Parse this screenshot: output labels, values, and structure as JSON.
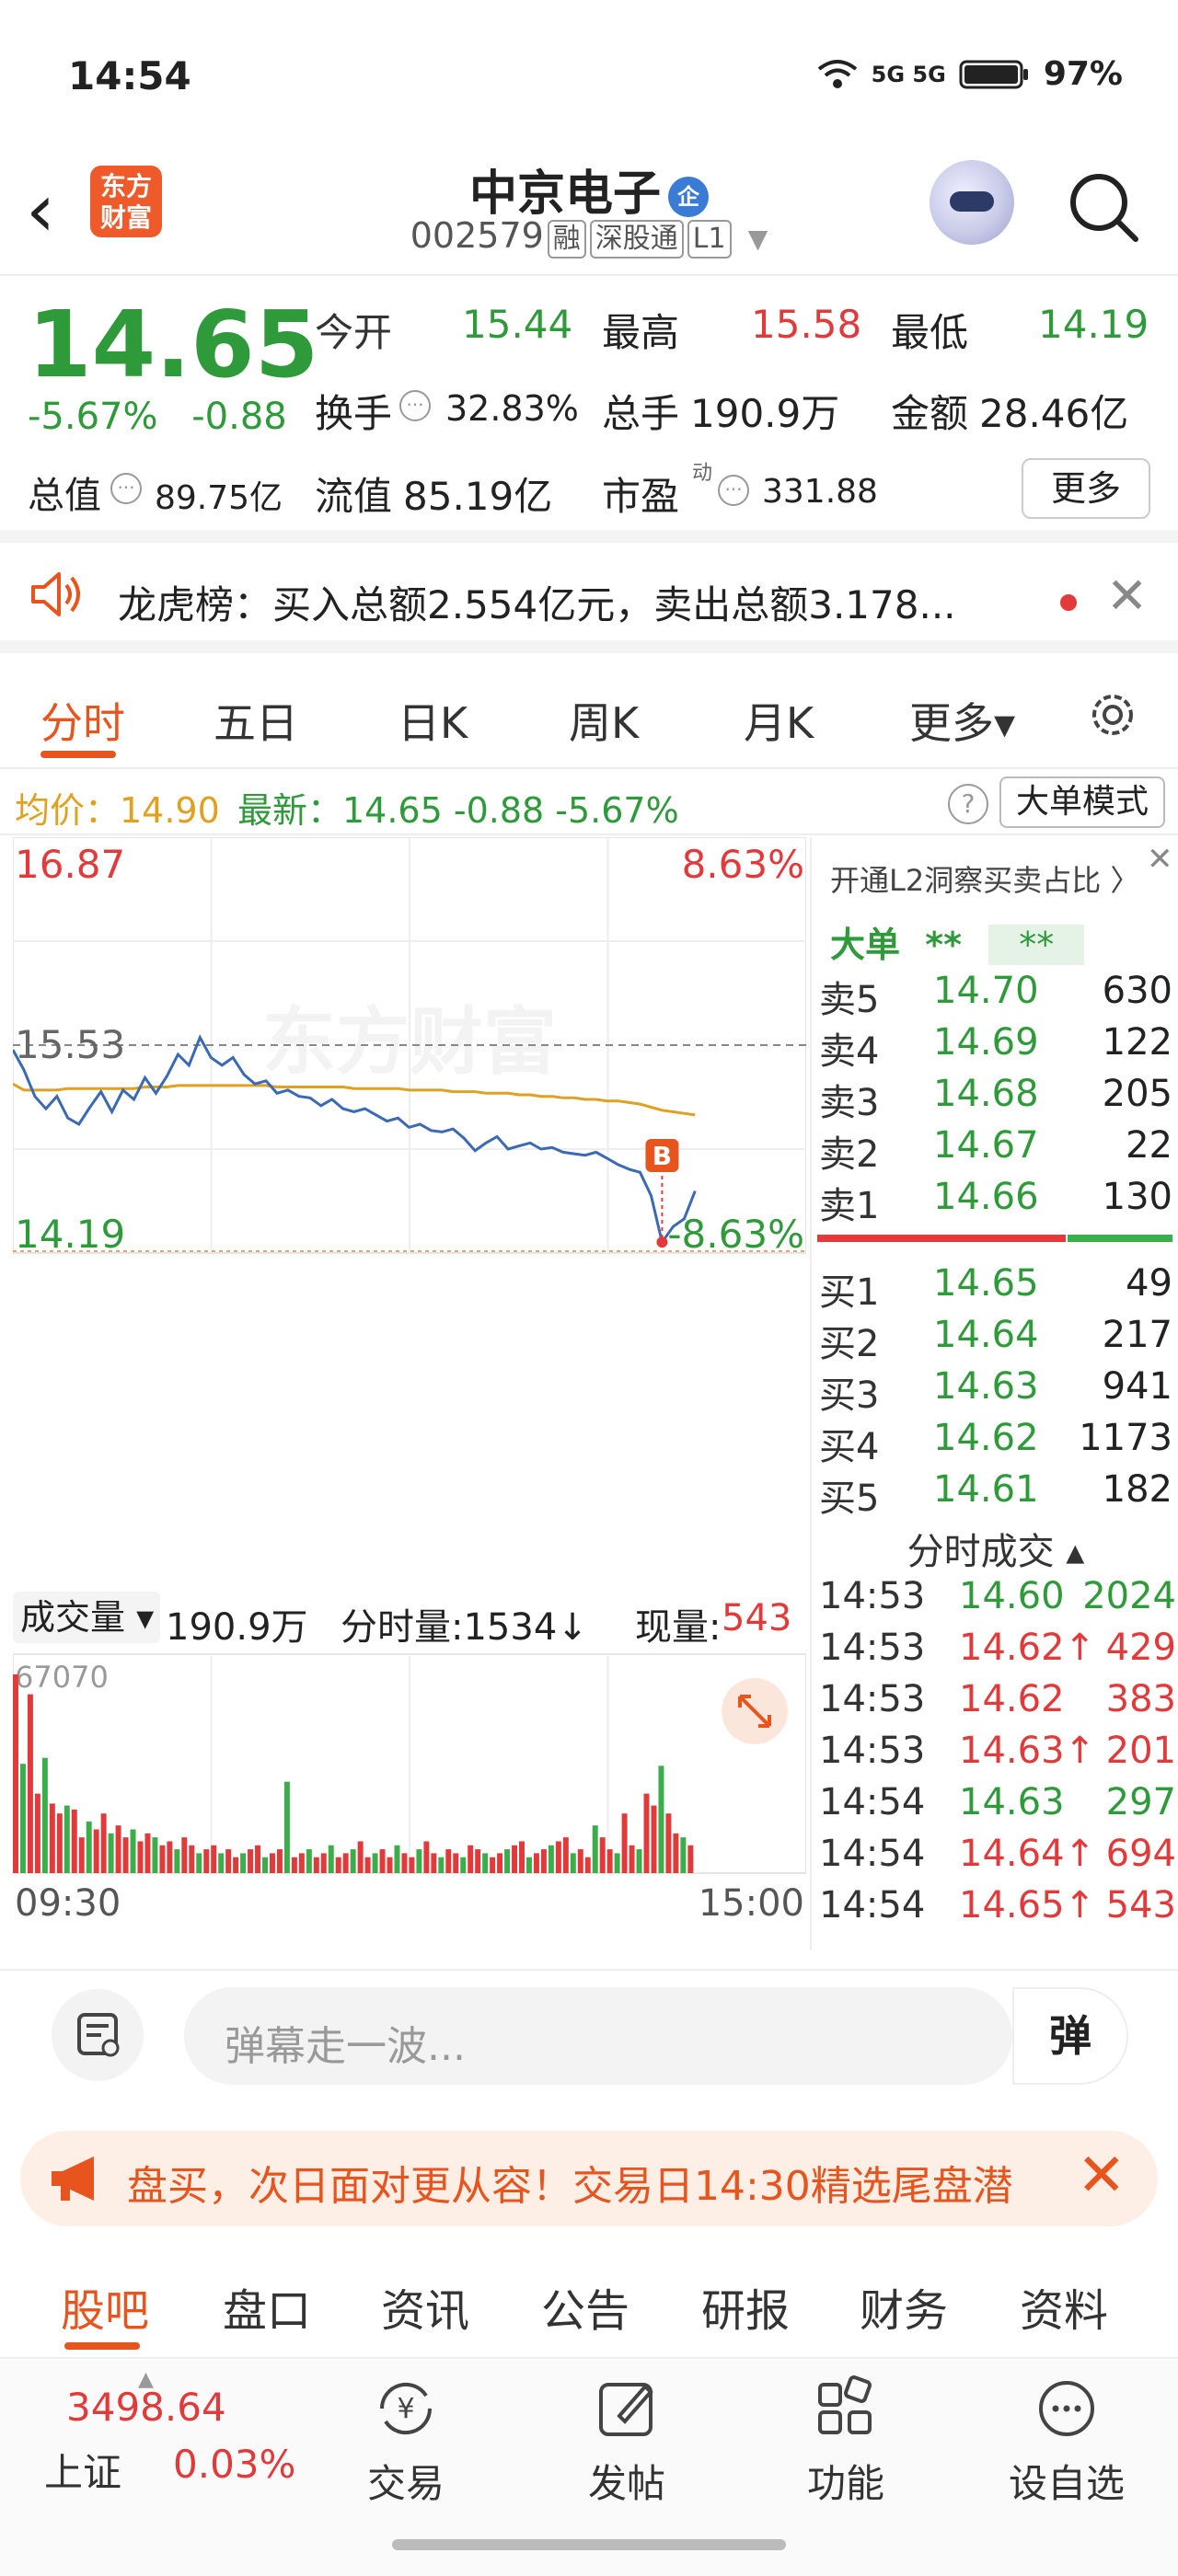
{
  "status_bar": {
    "time": "14:54",
    "network": "5G 5G",
    "battery": "97%"
  },
  "header": {
    "logo_text": "东方财富",
    "stock_name": "中京电子",
    "enterprise_badge": "企",
    "stock_code": "002579",
    "tags": [
      "融",
      "深股通",
      "L1"
    ]
  },
  "quote": {
    "price": "14.65",
    "change_pct": "-5.67%",
    "change": "-0.88",
    "fields": [
      {
        "label": "今开",
        "value": "15.44",
        "color": "#2e9a3a"
      },
      {
        "label": "最高",
        "value": "15.58",
        "color": "#e23a3a"
      },
      {
        "label": "最低",
        "value": "14.19",
        "color": "#2e9a3a"
      },
      {
        "label": "换手",
        "value": "32.83%",
        "color": "#222222"
      },
      {
        "label": "总手",
        "value": "190.9万",
        "color": "#222222"
      },
      {
        "label": "金额",
        "value": "28.46亿",
        "color": "#222222"
      },
      {
        "label": "总值",
        "value": "89.75亿",
        "color": "#222222"
      },
      {
        "label": "流值",
        "value": "85.19亿",
        "color": "#222222"
      },
      {
        "label": "市盈",
        "value": "331.88",
        "color": "#222222"
      }
    ],
    "pe_superscript": "动",
    "more_label": "更多"
  },
  "notice": {
    "text": "龙虎榜：买入总额2.554亿元，卖出总额3.178..."
  },
  "chart_tabs": [
    "分时",
    "五日",
    "日K",
    "周K",
    "月K",
    "更多▾"
  ],
  "avg_line": {
    "avg_label": "均价：14.90",
    "latest_label": "最新：14.65  -0.88  -5.67%",
    "help": "?",
    "mode_label": "大单模式"
  },
  "chart_labels": {
    "top_price": "16.87",
    "top_pct": "8.63%",
    "mid_price": "15.53",
    "bottom_price": "14.19",
    "bottom_pct": "-8.63%",
    "watermark": "东方财富",
    "marker": "B",
    "time_start": "09:30",
    "time_end": "15:00",
    "vol_max": "67070"
  },
  "chart_data": {
    "type": "line",
    "x_range": [
      "09:30",
      "15:00"
    ],
    "ylim": [
      14.19,
      16.87
    ],
    "pct_range": [
      "-8.63%",
      "8.63%"
    ],
    "prev_close": 15.53,
    "series": [
      {
        "values": [
          15.5,
          15.37,
          15.2,
          15.12,
          15.2,
          15.06,
          15.02,
          15.13,
          15.23,
          15.1,
          15.24,
          15.18,
          15.32,
          15.22,
          15.33,
          15.47,
          15.4,
          15.58,
          15.45,
          15.4,
          15.45,
          15.34,
          15.28,
          15.3,
          15.22,
          15.24,
          15.2,
          15.19,
          15.14,
          15.18,
          15.12,
          15.1,
          15.12,
          15.08,
          15.04,
          15.06,
          15.0,
          15.02,
          14.98,
          14.97,
          14.99,
          14.93,
          14.85,
          14.9,
          14.94,
          14.86,
          14.88,
          14.9,
          14.86,
          14.87,
          14.84,
          14.83,
          14.82,
          14.84,
          14.8,
          14.76,
          14.73,
          14.71,
          14.56,
          14.26,
          14.36,
          14.41,
          14.59
        ]
      },
      {
        "values": [
          15.28,
          15.24,
          15.24,
          15.24,
          15.24,
          15.25,
          15.25,
          15.25,
          15.25,
          15.25,
          15.25,
          15.25,
          15.26,
          15.26,
          15.26,
          15.27,
          15.27,
          15.27,
          15.27,
          15.27,
          15.27,
          15.27,
          15.27,
          15.27,
          15.26,
          15.26,
          15.26,
          15.26,
          15.26,
          15.26,
          15.26,
          15.25,
          15.25,
          15.25,
          15.25,
          15.25,
          15.24,
          15.24,
          15.24,
          15.24,
          15.23,
          15.23,
          15.23,
          15.22,
          15.22,
          15.22,
          15.21,
          15.21,
          15.2,
          15.2,
          15.19,
          15.19,
          15.18,
          15.18,
          15.17,
          15.17,
          15.16,
          15.15,
          15.13,
          15.11,
          15.1,
          15.09,
          15.08
        ]
      }
    ],
    "volume": [
      100,
      55,
      90,
      40,
      58,
      35,
      30,
      34,
      32,
      18,
      26,
      22,
      30,
      20,
      24,
      18,
      22,
      16,
      20,
      18,
      14,
      16,
      12,
      18,
      14,
      10,
      12,
      14,
      10,
      12,
      8,
      10,
      12,
      14,
      8,
      10,
      12,
      46,
      8,
      10,
      12,
      8,
      10,
      14,
      8,
      10,
      12,
      16,
      8,
      10,
      12,
      8,
      14,
      10,
      8,
      12,
      16,
      10,
      8,
      12,
      10,
      8,
      14,
      12,
      10,
      8,
      10,
      12,
      14,
      16,
      8,
      10,
      12,
      14,
      16,
      18,
      10,
      12,
      8,
      24,
      18,
      12,
      10,
      30,
      14,
      12,
      40,
      34,
      54,
      30,
      20,
      18,
      14
    ]
  },
  "volume_header": {
    "dropdown": "成交量 ▾",
    "total": "190.9万",
    "minute_vol": "分时量:1534↓",
    "current_label": "现量:",
    "current_value": "543"
  },
  "order_book": {
    "l2_text": "开通L2洞察买卖占比 〉",
    "big_label": "大单",
    "big_value": "**",
    "big_box": "**",
    "sells": [
      {
        "name": "卖5",
        "price": "14.70",
        "vol": "630"
      },
      {
        "name": "卖4",
        "price": "14.69",
        "vol": "122"
      },
      {
        "name": "卖3",
        "price": "14.68",
        "vol": "205"
      },
      {
        "name": "卖2",
        "price": "14.67",
        "vol": "22"
      },
      {
        "name": "卖1",
        "price": "14.66",
        "vol": "130"
      }
    ],
    "buys": [
      {
        "name": "买1",
        "price": "14.65",
        "vol": "49"
      },
      {
        "name": "买2",
        "price": "14.64",
        "vol": "217"
      },
      {
        "name": "买3",
        "price": "14.63",
        "vol": "941"
      },
      {
        "name": "买4",
        "price": "14.62",
        "vol": "1173"
      },
      {
        "name": "买5",
        "price": "14.61",
        "vol": "182"
      }
    ],
    "ticks_title": "分时成交 ▴",
    "ticks": [
      {
        "time": "14:53",
        "price": "14.60",
        "vol": "2024",
        "color": "#2e9a3a"
      },
      {
        "time": "14:53",
        "price": "14.62↑",
        "vol": "429",
        "color": "#e23a3a"
      },
      {
        "time": "14:53",
        "price": "14.62",
        "vol": "383",
        "color": "#e23a3a"
      },
      {
        "time": "14:53",
        "price": "14.63↑",
        "vol": "201",
        "color": "#e23a3a"
      },
      {
        "time": "14:54",
        "price": "14.63",
        "vol": "297",
        "color": "#2e9a3a"
      },
      {
        "time": "14:54",
        "price": "14.64↑",
        "vol": "694",
        "color": "#e23a3a"
      },
      {
        "time": "14:54",
        "price": "14.65↑",
        "vol": "543",
        "color": "#e23a3a"
      }
    ]
  },
  "comment_bar": {
    "placeholder": "弹幕走一波...",
    "danmaku_label": "弹"
  },
  "promo": {
    "text": "盘买，次日面对更从容！交易日14:30精选尾盘潜"
  },
  "bottom_tabs": [
    "股吧",
    "盘口",
    "资讯",
    "公告",
    "研报",
    "财务",
    "资料"
  ],
  "nav": {
    "index_value": "3498.64",
    "index_name": "上证",
    "index_pct": "0.03%",
    "items": [
      "交易",
      "发帖",
      "功能",
      "设自选"
    ]
  },
  "colors": {
    "accent": "#e8541d",
    "up": "#e23a3a",
    "down": "#2e9a3a",
    "avg": "#e0a020",
    "price_line": "#3a6ab5"
  }
}
